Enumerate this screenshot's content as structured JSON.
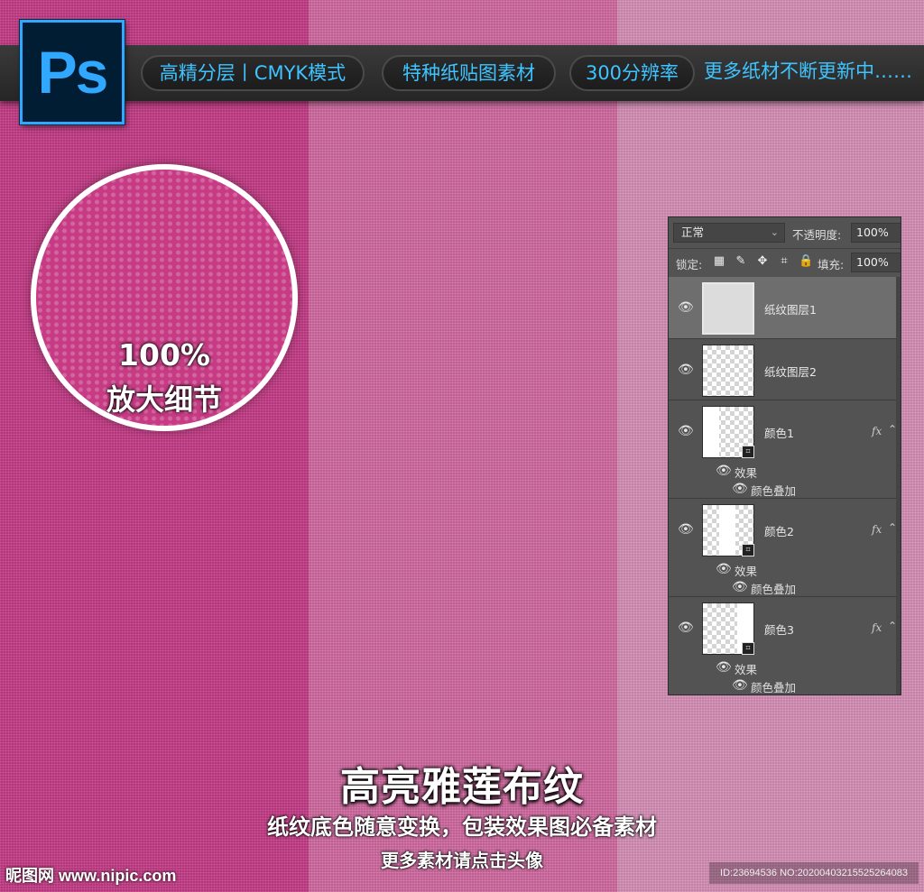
{
  "colors": {
    "stripe_1": "#c43c86",
    "stripe_2": "#d06aa0",
    "stripe_3": "#d58fb6",
    "ps_blue": "#31a8ff",
    "ps_dark": "#001d34",
    "pill_text": "#3fc4ff",
    "panel_bg": "#535353"
  },
  "header": {
    "logo_text": "Ps",
    "logo_icon": "photoshop-logo-icon",
    "tags": [
      "高精分层丨CMYK模式",
      "特种纸贴图素材",
      "300分辨率",
      "更多纸材不断更新中……"
    ]
  },
  "zoom": {
    "percent": "100%",
    "label": "放大细节"
  },
  "layers_panel": {
    "blend_mode": "正常",
    "opacity_label": "不透明度:",
    "opacity_value": "100%",
    "lock_label": "锁定:",
    "lock_icons": [
      "checker-lock-icon",
      "brush-lock-icon",
      "move-lock-icon",
      "artboard-lock-icon",
      "padlock-icon"
    ],
    "fill_label": "填充:",
    "fill_value": "100%",
    "layers": [
      {
        "name": "纸纹图层1",
        "selected": true
      },
      {
        "name": "纸纹图层2",
        "selected": false
      },
      {
        "name": "颜色1",
        "fx": "fx",
        "effects_label": "效果",
        "effect": "颜色叠加"
      },
      {
        "name": "颜色2",
        "fx": "fx",
        "effects_label": "效果",
        "effect": "颜色叠加"
      },
      {
        "name": "颜色3",
        "fx": "fx",
        "effects_label": "效果",
        "effect": "颜色叠加"
      }
    ]
  },
  "caption": {
    "title": "高亮雅莲布纹",
    "subtitle": "纸纹底色随意变换，包装效果图必备素材",
    "more": "更多素材请点击头像"
  },
  "watermark": {
    "site": "昵图网 www.nipic.com",
    "id_text": "ID:23694536 NO:20200403215525264083"
  }
}
